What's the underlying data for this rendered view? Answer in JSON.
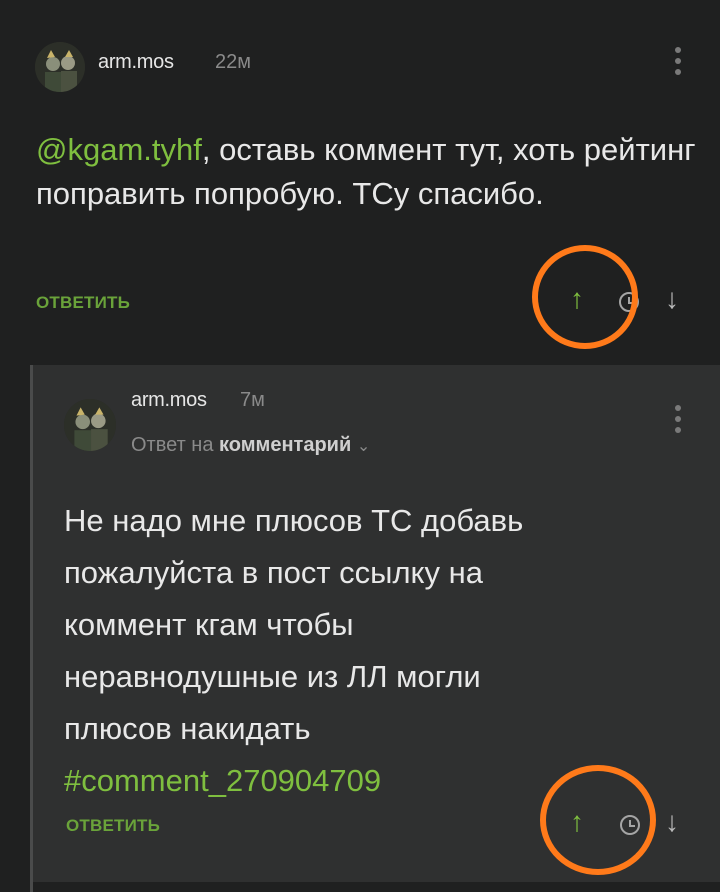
{
  "colors": {
    "background": "#1f2020",
    "reply_background": "#2f3030",
    "accent_green": "#7fbf3f",
    "highlight_orange": "#ff7a1a"
  },
  "comment": {
    "username": "arm.mos",
    "time": "22м",
    "mention": "@kgam.tyhf",
    "text_after_mention": ", оставь коммент тут, хоть рейтинг поправить попробую. ТСу спасибо.",
    "reply_label": "ОТВЕТИТЬ",
    "upvote_icon": "arrow-up-icon",
    "downvote_icon": "arrow-down-icon",
    "menu_icon": "kebab-menu-icon"
  },
  "reply": {
    "username": "arm.mos",
    "time": "7м",
    "reply_to_prefix": "Ответ на",
    "reply_to_target": "комментарий",
    "chevron": "⌄",
    "text": "Не надо мне плюсов ТС добавь пожалуйста в пост ссылку на коммент кгам чтобы неравнодушные из ЛЛ могли плюсов накидать",
    "hashtag": "#comment_270904709",
    "reply_label": "ОТВЕТИТЬ",
    "upvote_icon": "arrow-up-icon",
    "downvote_icon": "arrow-down-icon",
    "menu_icon": "kebab-menu-icon"
  }
}
